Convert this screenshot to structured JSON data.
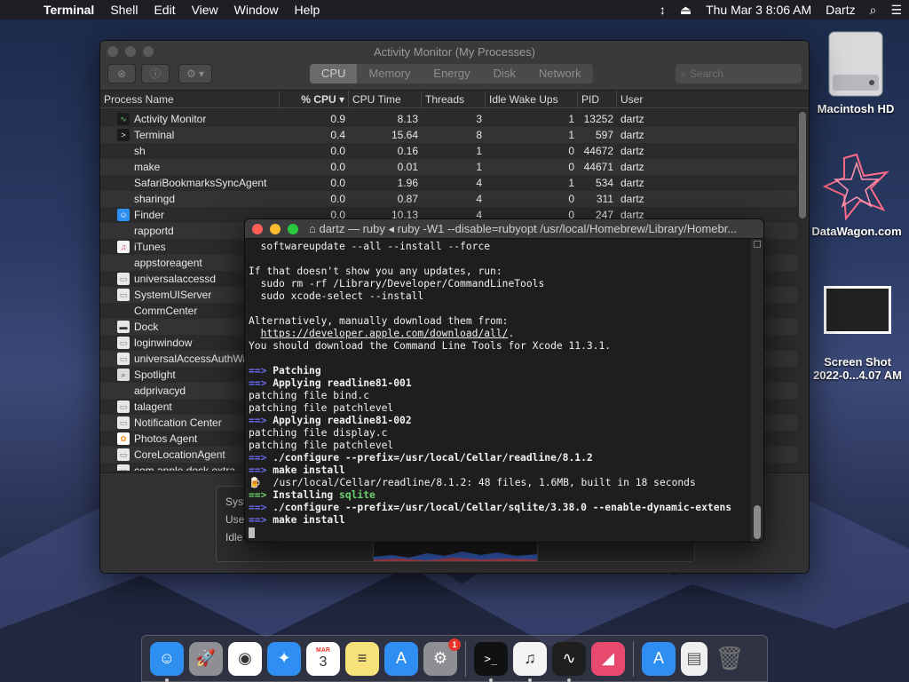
{
  "menubar": {
    "app": "Terminal",
    "items": [
      "Shell",
      "Edit",
      "View",
      "Window",
      "Help"
    ],
    "datetime": "Thu Mar 3  8:06 AM",
    "user": "Dartz"
  },
  "desktop": {
    "hd_label": "Macintosh HD",
    "datawagon_label": "DataWagon.com",
    "screenshot_label1": "Screen Shot",
    "screenshot_label2": "2022-0...4.07 AM"
  },
  "activity_monitor": {
    "title": "Activity Monitor (My Processes)",
    "tabs": [
      "CPU",
      "Memory",
      "Energy",
      "Disk",
      "Network"
    ],
    "active_tab": "CPU",
    "search_placeholder": "Search",
    "columns": [
      "Process Name",
      "% CPU",
      "CPU Time",
      "Threads",
      "Idle Wake Ups",
      "PID",
      "User"
    ],
    "rows": [
      {
        "name": "Activity Monitor",
        "cpu": "0.9",
        "time": "8.13",
        "threads": "3",
        "idle": "1",
        "pid": "13252",
        "user": "dartz",
        "icon": "activity-monitor-icon"
      },
      {
        "name": "Terminal",
        "cpu": "0.4",
        "time": "15.64",
        "threads": "8",
        "idle": "1",
        "pid": "597",
        "user": "dartz",
        "icon": "terminal-icon"
      },
      {
        "name": "sh",
        "cpu": "0.0",
        "time": "0.16",
        "threads": "1",
        "idle": "0",
        "pid": "44672",
        "user": "dartz",
        "icon": ""
      },
      {
        "name": "make",
        "cpu": "0.0",
        "time": "0.01",
        "threads": "1",
        "idle": "0",
        "pid": "44671",
        "user": "dartz",
        "icon": ""
      },
      {
        "name": "SafariBookmarksSyncAgent",
        "cpu": "0.0",
        "time": "1.96",
        "threads": "4",
        "idle": "1",
        "pid": "534",
        "user": "dartz",
        "icon": ""
      },
      {
        "name": "sharingd",
        "cpu": "0.0",
        "time": "0.87",
        "threads": "4",
        "idle": "0",
        "pid": "311",
        "user": "dartz",
        "icon": ""
      },
      {
        "name": "Finder",
        "cpu": "0.0",
        "time": "10.13",
        "threads": "4",
        "idle": "0",
        "pid": "247",
        "user": "dartz",
        "icon": "finder-icon"
      },
      {
        "name": "rapportd",
        "cpu": "",
        "time": "",
        "threads": "",
        "idle": "",
        "pid": "",
        "user": "",
        "icon": ""
      },
      {
        "name": "iTunes",
        "cpu": "",
        "time": "",
        "threads": "",
        "idle": "",
        "pid": "",
        "user": "",
        "icon": "itunes-icon"
      },
      {
        "name": "appstoreagent",
        "cpu": "",
        "time": "",
        "threads": "",
        "idle": "",
        "pid": "",
        "user": "",
        "icon": ""
      },
      {
        "name": "universalaccessd",
        "cpu": "",
        "time": "",
        "threads": "",
        "idle": "",
        "pid": "",
        "user": "",
        "icon": "generic-app-icon"
      },
      {
        "name": "SystemUIServer",
        "cpu": "",
        "time": "",
        "threads": "",
        "idle": "",
        "pid": "",
        "user": "",
        "icon": "generic-app-icon"
      },
      {
        "name": "CommCenter",
        "cpu": "",
        "time": "",
        "threads": "",
        "idle": "",
        "pid": "",
        "user": "",
        "icon": ""
      },
      {
        "name": "Dock",
        "cpu": "",
        "time": "",
        "threads": "",
        "idle": "",
        "pid": "",
        "user": "",
        "icon": "dock-icon"
      },
      {
        "name": "loginwindow",
        "cpu": "",
        "time": "",
        "threads": "",
        "idle": "",
        "pid": "",
        "user": "",
        "icon": "generic-app-icon"
      },
      {
        "name": "universalAccessAuthWa",
        "cpu": "",
        "time": "",
        "threads": "",
        "idle": "",
        "pid": "",
        "user": "",
        "icon": "generic-app-icon"
      },
      {
        "name": "Spotlight",
        "cpu": "",
        "time": "",
        "threads": "",
        "idle": "",
        "pid": "",
        "user": "",
        "icon": "spotlight-icon"
      },
      {
        "name": "adprivacyd",
        "cpu": "",
        "time": "",
        "threads": "",
        "idle": "",
        "pid": "",
        "user": "",
        "icon": ""
      },
      {
        "name": "talagent",
        "cpu": "",
        "time": "",
        "threads": "",
        "idle": "",
        "pid": "",
        "user": "",
        "icon": "generic-app-icon"
      },
      {
        "name": "Notification Center",
        "cpu": "",
        "time": "",
        "threads": "",
        "idle": "",
        "pid": "",
        "user": "",
        "icon": "generic-app-icon"
      },
      {
        "name": "Photos Agent",
        "cpu": "",
        "time": "",
        "threads": "",
        "idle": "",
        "pid": "",
        "user": "",
        "icon": "photos-icon"
      },
      {
        "name": "CoreLocationAgent",
        "cpu": "",
        "time": "",
        "threads": "",
        "idle": "",
        "pid": "",
        "user": "",
        "icon": "generic-app-icon"
      },
      {
        "name": "com.apple.dock.extra",
        "cpu": "",
        "time": "",
        "threads": "",
        "idle": "",
        "pid": "",
        "user": "",
        "icon": "generic-app-icon"
      }
    ],
    "bottom_labels": [
      "Syst",
      "Use",
      "Idle"
    ]
  },
  "terminal": {
    "title": "dartz — ruby ◂ ruby -W1 --disable=rubyopt /usr/local/Homebrew/Library/Homebr...",
    "lines": [
      {
        "parts": [
          {
            "t": "  softwareupdate --all --install --force",
            "c": ""
          }
        ]
      },
      {
        "parts": [
          {
            "t": "",
            "c": ""
          }
        ]
      },
      {
        "parts": [
          {
            "t": "If that doesn't show you any updates, run:",
            "c": ""
          }
        ]
      },
      {
        "parts": [
          {
            "t": "  sudo rm -rf /Library/Developer/CommandLineTools",
            "c": ""
          }
        ]
      },
      {
        "parts": [
          {
            "t": "  sudo xcode-select --install",
            "c": ""
          }
        ]
      },
      {
        "parts": [
          {
            "t": "",
            "c": ""
          }
        ]
      },
      {
        "parts": [
          {
            "t": "Alternatively, manually download them from:",
            "c": ""
          }
        ]
      },
      {
        "parts": [
          {
            "t": "  ",
            "c": ""
          },
          {
            "t": "https://developer.apple.com/download/all/",
            "c": "u"
          },
          {
            "t": ".",
            "c": ""
          }
        ]
      },
      {
        "parts": [
          {
            "t": "You should download the Command Line Tools for Xcode 11.3.1.",
            "c": ""
          }
        ]
      },
      {
        "parts": [
          {
            "t": "",
            "c": ""
          }
        ]
      },
      {
        "parts": [
          {
            "t": "==>",
            "c": "arrow"
          },
          {
            "t": " Patching",
            "c": "b"
          }
        ]
      },
      {
        "parts": [
          {
            "t": "==>",
            "c": "arrow"
          },
          {
            "t": " Applying readline81-001",
            "c": "b"
          }
        ]
      },
      {
        "parts": [
          {
            "t": "patching file bind.c",
            "c": ""
          }
        ]
      },
      {
        "parts": [
          {
            "t": "patching file patchlevel",
            "c": ""
          }
        ]
      },
      {
        "parts": [
          {
            "t": "==>",
            "c": "arrow"
          },
          {
            "t": " Applying readline81-002",
            "c": "b"
          }
        ]
      },
      {
        "parts": [
          {
            "t": "patching file display.c",
            "c": ""
          }
        ]
      },
      {
        "parts": [
          {
            "t": "patching file patchlevel",
            "c": ""
          }
        ]
      },
      {
        "parts": [
          {
            "t": "==>",
            "c": "arrow"
          },
          {
            "t": " ./configure --prefix=/usr/local/Cellar/readline/8.1.2",
            "c": "b"
          }
        ]
      },
      {
        "parts": [
          {
            "t": "==>",
            "c": "arrow"
          },
          {
            "t": " make install",
            "c": "b"
          }
        ]
      },
      {
        "parts": [
          {
            "t": "🍺",
            "c": ""
          },
          {
            "t": "  /usr/local/Cellar/readline/8.1.2: 48 files, 1.6MB, built in 18 seconds",
            "c": ""
          }
        ]
      },
      {
        "parts": [
          {
            "t": "==>",
            "c": "arrow-g"
          },
          {
            "t": " Installing ",
            "c": "b"
          },
          {
            "t": "sqlite",
            "c": "g"
          }
        ]
      },
      {
        "parts": [
          {
            "t": "==>",
            "c": "arrow"
          },
          {
            "t": " ./configure --prefix=/usr/local/Cellar/sqlite/3.38.0 --enable-dynamic-extens",
            "c": "b"
          }
        ]
      },
      {
        "parts": [
          {
            "t": "==>",
            "c": "arrow"
          },
          {
            "t": " make install",
            "c": "b"
          }
        ]
      }
    ]
  },
  "dock": {
    "apps": [
      {
        "name": "finder",
        "glyph": "☺",
        "bg": "#2d8ff0",
        "running": true
      },
      {
        "name": "launchpad",
        "glyph": "🚀",
        "bg": "#8e8e93",
        "running": false
      },
      {
        "name": "chrome",
        "glyph": "◉",
        "bg": "#ffffff",
        "running": false
      },
      {
        "name": "safari",
        "glyph": "✦",
        "bg": "#2f8ef2",
        "running": false
      },
      {
        "name": "calendar",
        "glyph": "3",
        "bg": "#ffffff",
        "running": false
      },
      {
        "name": "notes",
        "glyph": "≡",
        "bg": "#f7e27a",
        "running": false
      },
      {
        "name": "app-store",
        "glyph": "A",
        "bg": "#2f8ef2",
        "running": false
      },
      {
        "name": "system-preferences",
        "glyph": "⚙",
        "bg": "#8e8e93",
        "running": false
      },
      {
        "name": "terminal",
        "glyph": ">_",
        "bg": "#111111",
        "running": true
      },
      {
        "name": "itunes",
        "glyph": "♫",
        "bg": "#f4f4f4",
        "running": true
      },
      {
        "name": "activity-monitor",
        "glyph": "∿",
        "bg": "#1f1f1f",
        "running": true
      },
      {
        "name": "grapher",
        "glyph": "◢",
        "bg": "#e84a6f",
        "running": false
      }
    ],
    "system_prefs_badge": "1",
    "calendar_month": "MAR",
    "calendar_day": "3"
  }
}
